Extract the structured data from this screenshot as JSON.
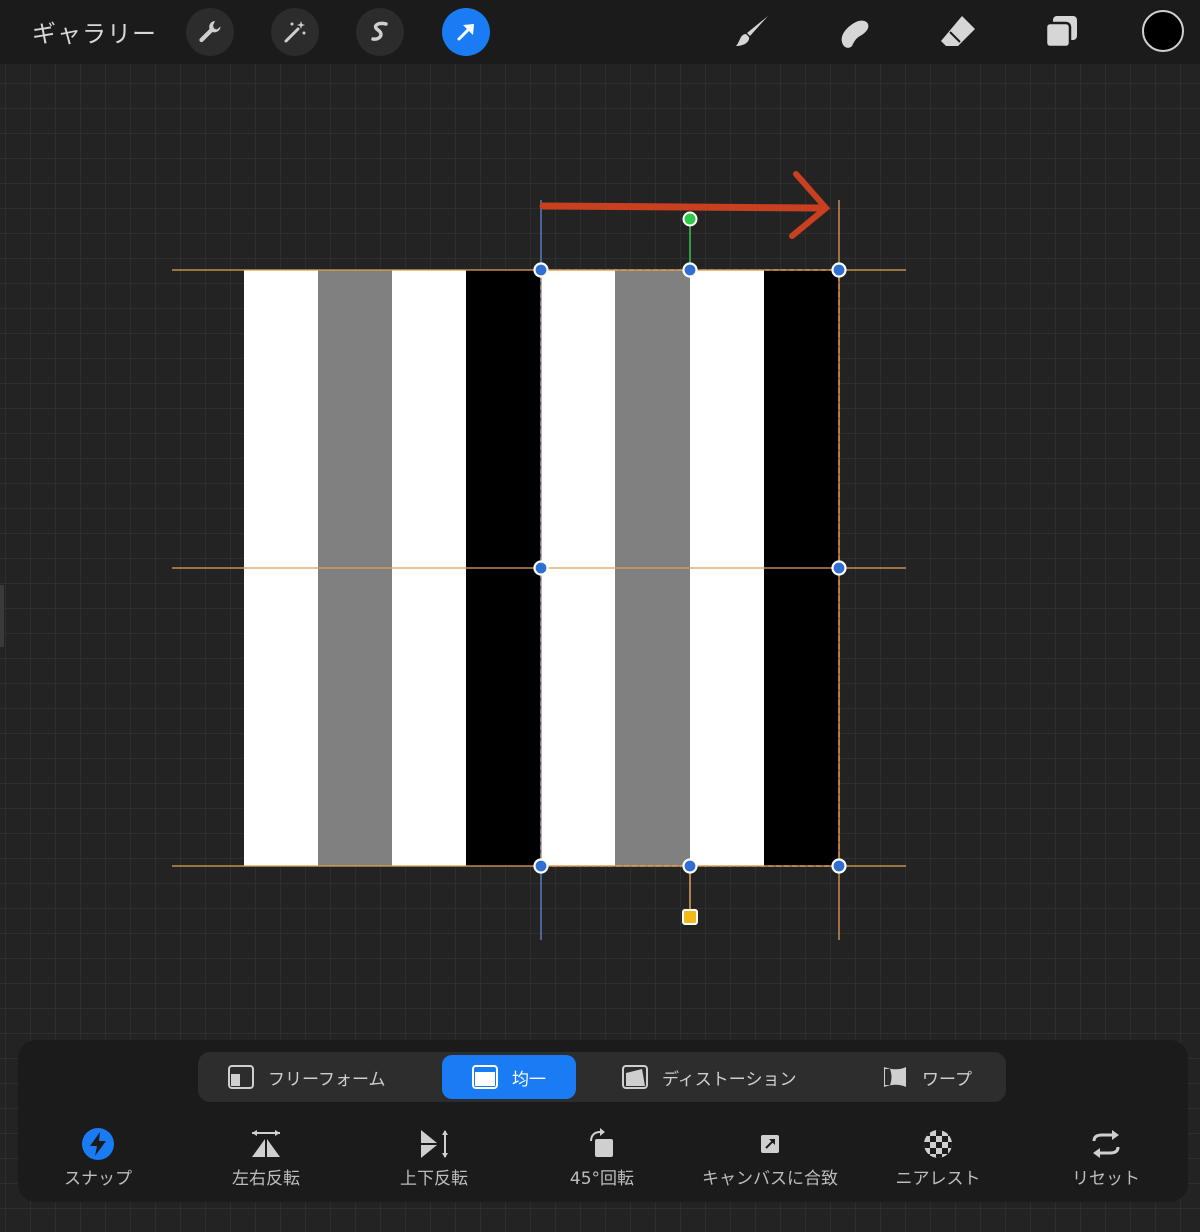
{
  "topbar": {
    "gallery_label": "ギャラリー",
    "tools_left": [
      {
        "icon": "wrench-icon",
        "name": "actions"
      },
      {
        "icon": "magic-wand-icon",
        "name": "adjustments"
      },
      {
        "icon": "selection-s-icon",
        "name": "selection"
      },
      {
        "icon": "transform-arrow-icon",
        "name": "transform",
        "active": true
      }
    ],
    "tools_right": [
      {
        "icon": "brush-icon",
        "name": "paint"
      },
      {
        "icon": "smudge-icon",
        "name": "smudge"
      },
      {
        "icon": "eraser-icon",
        "name": "erase"
      },
      {
        "icon": "layers-icon",
        "name": "layers"
      }
    ],
    "current_color": "#000000"
  },
  "colors": {
    "accent_blue": "#1a7cf5",
    "handle_blue": "#2f6fd1",
    "guide_orange": "#e0a25a",
    "rotation_green": "#31c94a",
    "anchor_yellow": "#f2b91a",
    "annotation_red": "#c8401f",
    "stripe_white": "#ffffff",
    "stripe_gray": "#808080",
    "stripe_black": "#000000"
  },
  "modes": [
    {
      "label": "フリーフォーム",
      "icon": "freeform-icon",
      "active": false
    },
    {
      "label": "均一",
      "icon": "uniform-icon",
      "active": true
    },
    {
      "label": "ディストーション",
      "icon": "distort-icon",
      "active": false
    },
    {
      "label": "ワープ",
      "icon": "warp-icon",
      "active": false
    }
  ],
  "actions": [
    {
      "label": "スナップ",
      "icon": "snap-bolt-icon",
      "active": true
    },
    {
      "label": "左右反転",
      "icon": "flip-horizontal-icon"
    },
    {
      "label": "上下反転",
      "icon": "flip-vertical-icon"
    },
    {
      "label": "45°回転",
      "icon": "rotate-45-icon"
    },
    {
      "label": "キャンバスに合致",
      "icon": "fit-canvas-icon"
    },
    {
      "label": "ニアレスト",
      "icon": "nearest-interp-icon"
    },
    {
      "label": "リセット",
      "icon": "reset-icon"
    }
  ]
}
